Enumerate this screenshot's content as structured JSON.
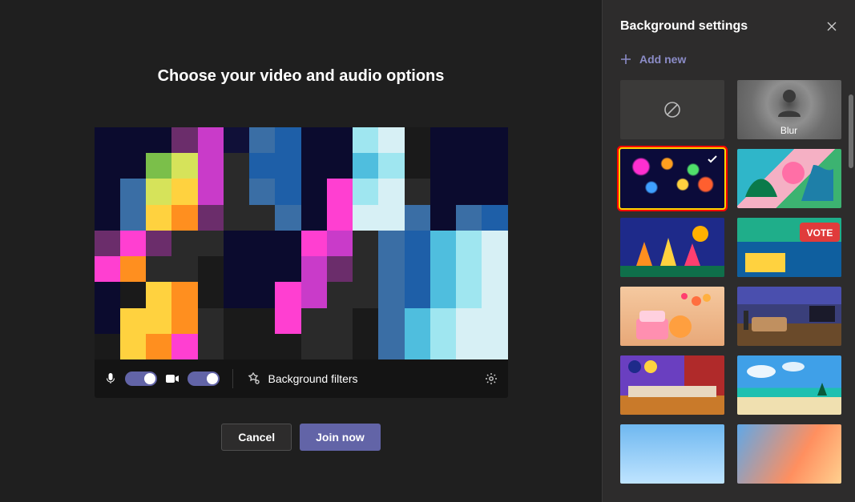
{
  "main": {
    "title": "Choose your video and audio options",
    "bg_filters_label": "Background filters",
    "cancel_label": "Cancel",
    "join_label": "Join now"
  },
  "side": {
    "title": "Background settings",
    "add_new_label": "Add new",
    "thumbs": [
      {
        "id": "none",
        "label": ""
      },
      {
        "id": "blur",
        "label": "Blur"
      },
      {
        "id": "bokeh",
        "label": "",
        "selected": true
      },
      {
        "id": "floral",
        "label": ""
      },
      {
        "id": "hands",
        "label": ""
      },
      {
        "id": "vote",
        "label": ""
      },
      {
        "id": "cake",
        "label": ""
      },
      {
        "id": "room",
        "label": ""
      },
      {
        "id": "studio",
        "label": ""
      },
      {
        "id": "beach",
        "label": ""
      },
      {
        "id": "sky",
        "label": ""
      },
      {
        "id": "sky2",
        "label": ""
      }
    ]
  }
}
